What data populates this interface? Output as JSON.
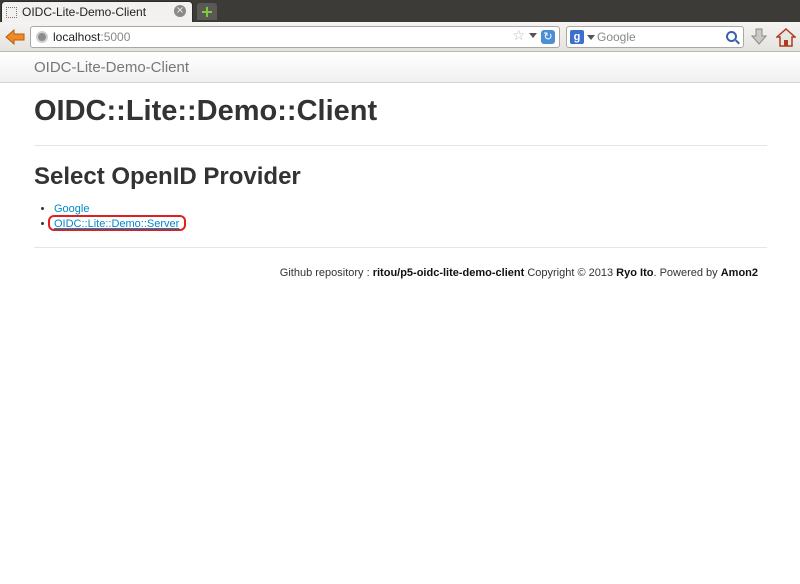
{
  "browser": {
    "tab_title": "OIDC-Lite-Demo-Client",
    "url_host": "localhost",
    "url_port": ":5000",
    "search_placeholder": "Google",
    "search_engine_letter": "g"
  },
  "header": {
    "brand": "OIDC-Lite-Demo-Client"
  },
  "main": {
    "title": "OIDC::Lite::Demo::Client",
    "section_title": "Select OpenID Provider",
    "providers": [
      {
        "label": "Google"
      },
      {
        "label": "OIDC::Lite::Demo::Server"
      }
    ]
  },
  "footer": {
    "repo_prefix": "Github repository : ",
    "repo_name": "ritou/p5-oidc-lite-demo-client",
    "copyright_prefix": " Copyright © 2013 ",
    "author": "Ryo Ito",
    "powered_prefix": ". Powered by ",
    "framework": "Amon2"
  },
  "colors": {
    "link": "#0088cc",
    "highlight": "#e02020",
    "heading": "#333333"
  }
}
